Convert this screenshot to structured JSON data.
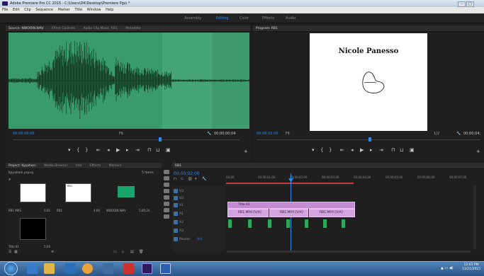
{
  "window": {
    "title": "Adobe Premiere Pro CC 2015 - C:\\Users\\DK\\Desktop\\Premiere Pgs\\ *",
    "controls": [
      "–",
      "□",
      "✕"
    ]
  },
  "menu": [
    "File",
    "Edit",
    "Clip",
    "Sequence",
    "Marker",
    "Title",
    "Window",
    "Help"
  ],
  "workspaces": [
    "Assembly",
    "Editing",
    "Color",
    "Effects",
    "Audio"
  ],
  "workspace_active": "Editing",
  "source": {
    "tabs": [
      "Source: NWOOIN.WAV",
      "Effect Controls",
      "Audio Clip Mixer: RB1",
      "Metadata"
    ],
    "timecode_in": "00;00;00;00",
    "fit": "Fit",
    "timecode_out": "00;00;00;04"
  },
  "program": {
    "tab": "Program: RB1",
    "timecode": "00;00;02;00",
    "fit": "Fit",
    "quality": "1/2",
    "duration": "00;00;04;",
    "title_text": "Nicole Panesso"
  },
  "transport_icons": [
    "marker-icon",
    "mark-in-icon",
    "mark-out-icon",
    "go-to-in-icon",
    "step-back-icon",
    "play-icon",
    "step-forward-icon",
    "go-to-out-icon",
    "insert-icon",
    "overwrite-icon",
    "export-frame-icon"
  ],
  "project": {
    "tabs": [
      "Project: Kyyahani",
      "Media Browser",
      "Info",
      "Effects",
      "Markers"
    ],
    "bin": "Kyyahani.prproj",
    "item_count": "5 Items",
    "thumb_labels": [
      "RB1",
      ""
    ],
    "items": [
      {
        "name": "RB1 MRS",
        "dur": "5;01"
      },
      {
        "name": "RB1",
        "dur": "4;00"
      },
      {
        "name": "NWOOIN.WAV",
        "dur": "5;00;24"
      }
    ],
    "lower_item": {
      "name": "Title 01",
      "dur": "5;00"
    }
  },
  "timeline": {
    "tab": "RB1",
    "timecode": "00;00;02;00",
    "ruler": [
      "00;00",
      "00;00;01;00",
      "00;00;02;00",
      "00;00;03;00",
      "00;00;04;00",
      "00;00;05;00",
      "00;00;06;00",
      "00;00;07;00"
    ],
    "tracks": [
      {
        "name": "V3",
        "label": "V3"
      },
      {
        "name": "V2",
        "label": "V2"
      },
      {
        "name": "V1",
        "label": "V1"
      },
      {
        "name": "A1",
        "label": "A1"
      },
      {
        "name": "A2",
        "label": "A2"
      },
      {
        "name": "A3",
        "label": "A3"
      },
      {
        "name": "Master",
        "label": "Master"
      }
    ],
    "master_value": "0.0",
    "title_clip": "Title 01",
    "v1_clips": [
      "RB1.MP4 [V/A]",
      "RB1.MP4 [V/A]",
      "RB1.MP4 [V/A]"
    ]
  },
  "taskbar": {
    "apps": [
      "ie-icon",
      "explorer-icon",
      "media-player-icon",
      "chrome-icon",
      "paint-icon",
      "folder-icon",
      "premiere-icon",
      "word-icon"
    ],
    "time": "12:01 PM",
    "date": "11/21/2015"
  },
  "colors": {
    "accent": "#2d8ceb",
    "waveform_bg": "#3a9b6a",
    "title_clip": "#c38bd3",
    "audio_clip": "#2da85a"
  }
}
